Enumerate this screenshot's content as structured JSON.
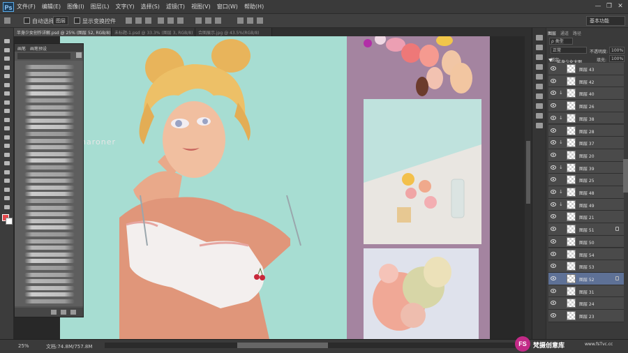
{
  "app": {
    "logo": "Ps"
  },
  "menu": [
    "文件(F)",
    "编辑(E)",
    "图像(I)",
    "图层(L)",
    "文字(Y)",
    "选择(S)",
    "滤镜(T)",
    "视图(V)",
    "窗口(W)",
    "帮助(H)"
  ],
  "window_controls": {
    "minimize": "—",
    "restore": "❐",
    "close": "✕"
  },
  "options": {
    "auto_select_label": "自动选择:",
    "auto_select_value": "图层",
    "show_transform_label": "显示变换控件",
    "workspace": "基本功能"
  },
  "tabs": [
    {
      "label": "半身少女创作详解.psd @ 25% (图层 52, RGB/8) *",
      "active": true
    },
    {
      "label": "未标题-1.psd @ 33.3% (图层 3, RGB/8)",
      "active": false
    },
    {
      "label": "合图展示.jpg @ 43.5%(RGB/8)",
      "active": false
    }
  ],
  "brush_panel": {
    "tab1": "画笔",
    "tab2": "画笔预设"
  },
  "canvas_signature": "charoner",
  "layers_panel": {
    "tabs": [
      "图层",
      "通道",
      "路径"
    ],
    "kind_filter": "ρ 类型",
    "blend_mode": "正常",
    "opacity_label": "不透明度:",
    "opacity_value": "100%",
    "lock_label": "锁定:",
    "fill_label": "填充:",
    "fill_value": "100%",
    "group_name": "半身少女大图",
    "layers": [
      {
        "name": "图层 43",
        "clip": false,
        "lock": false,
        "selected": false
      },
      {
        "name": "图层 42",
        "clip": false,
        "lock": false,
        "selected": false
      },
      {
        "name": "图层 40",
        "clip": true,
        "lock": false,
        "selected": false
      },
      {
        "name": "图层 26",
        "clip": false,
        "lock": false,
        "selected": false
      },
      {
        "name": "图层 38",
        "clip": true,
        "lock": false,
        "selected": false
      },
      {
        "name": "图层 28",
        "clip": false,
        "lock": false,
        "selected": false
      },
      {
        "name": "图层 37",
        "clip": true,
        "lock": false,
        "selected": false
      },
      {
        "name": "图层 20",
        "clip": false,
        "lock": false,
        "selected": false
      },
      {
        "name": "图层 39",
        "clip": true,
        "lock": false,
        "selected": false
      },
      {
        "name": "图层 25",
        "clip": false,
        "lock": false,
        "selected": false
      },
      {
        "name": "图层 48",
        "clip": true,
        "lock": false,
        "selected": false
      },
      {
        "name": "图层 49",
        "clip": true,
        "lock": false,
        "selected": false
      },
      {
        "name": "图层 21",
        "clip": false,
        "lock": false,
        "selected": false
      },
      {
        "name": "图层 51",
        "clip": false,
        "lock": true,
        "selected": false
      },
      {
        "name": "图层 50",
        "clip": false,
        "lock": false,
        "selected": false
      },
      {
        "name": "图层 54",
        "clip": false,
        "lock": false,
        "selected": false
      },
      {
        "name": "图层 53",
        "clip": false,
        "lock": false,
        "selected": false
      },
      {
        "name": "图层 52",
        "clip": false,
        "lock": true,
        "selected": true
      },
      {
        "name": "图层 31",
        "clip": false,
        "lock": false,
        "selected": false
      },
      {
        "name": "图层 24",
        "clip": false,
        "lock": false,
        "selected": false
      },
      {
        "name": "图层 23",
        "clip": false,
        "lock": false,
        "selected": false
      }
    ]
  },
  "status": {
    "zoom": "25%",
    "doc": "文档:74.8M/757.8M"
  },
  "watermark": {
    "logo": "FS",
    "name": "梵摄创意库",
    "url": "www.fsTvc.cc"
  },
  "colors": {
    "foreground": "#e4474b",
    "background": "#ffffff",
    "canvas_bg": "#a7ddd2",
    "board": "#a484a0"
  }
}
